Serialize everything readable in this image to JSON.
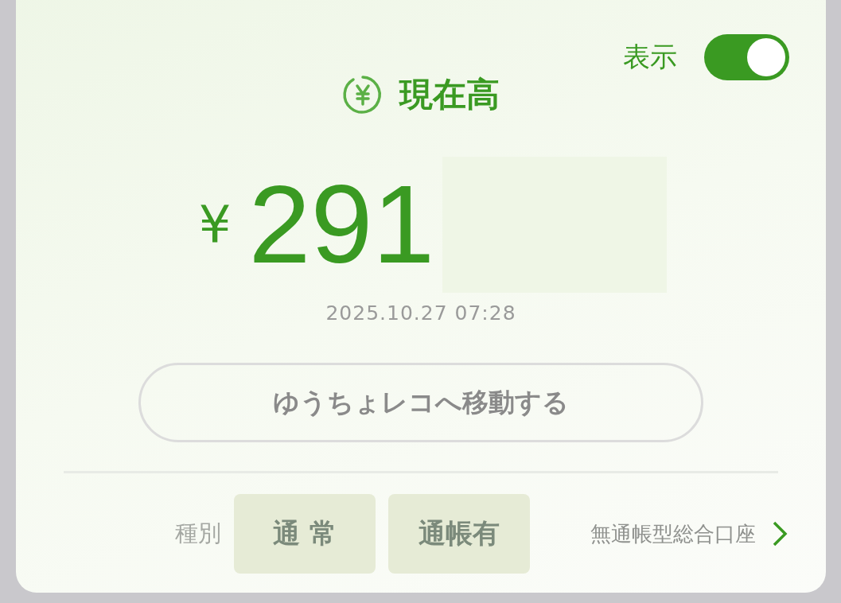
{
  "toggle": {
    "label": "表示",
    "on": true
  },
  "title": "現在高",
  "balance": {
    "currency": "¥",
    "amount": "291",
    "masked": true
  },
  "timestamp": "2025.10.27 07:28",
  "link_button": "ゆうちょレコへ移動する",
  "account": {
    "label": "種別",
    "tags": [
      "通 常",
      "通帳有"
    ],
    "type_link": "無通帳型総合口座"
  }
}
